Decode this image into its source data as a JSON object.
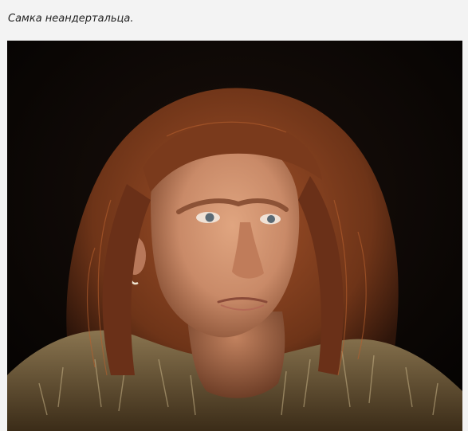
{
  "post": {
    "caption": "Самка неандертальца."
  },
  "image": {
    "subject": "neanderthal-female-portrait",
    "background_color": "#0b0705",
    "hair_color": "#7a3a1c",
    "skin_color": "#c98a68",
    "fur_color": "#6b5636"
  }
}
